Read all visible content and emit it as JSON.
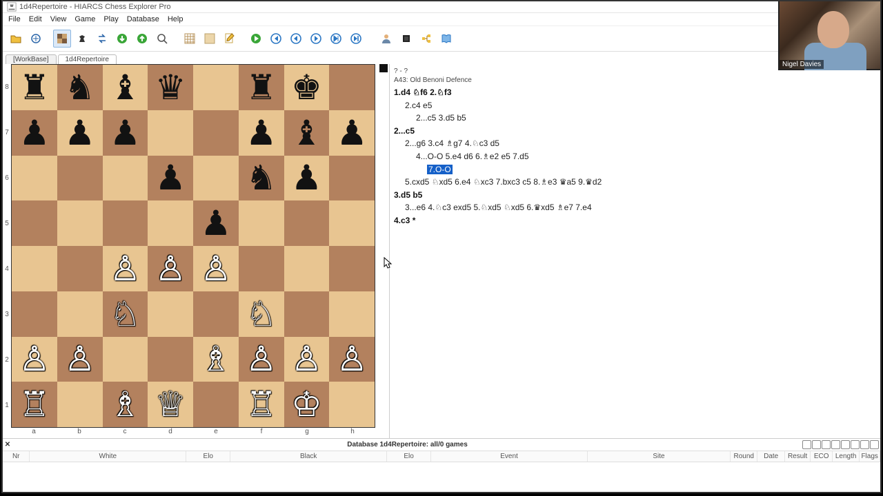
{
  "window": {
    "title": "1d4Repertoire - HIARCS Chess Explorer Pro"
  },
  "menus": [
    "File",
    "Edit",
    "View",
    "Game",
    "Play",
    "Database",
    "Help"
  ],
  "tabs": [
    {
      "label": "[WorkBase]",
      "active": false
    },
    {
      "label": "1d4Repertoire",
      "active": true
    }
  ],
  "board": {
    "files": [
      "a",
      "b",
      "c",
      "d",
      "e",
      "f",
      "g",
      "h"
    ],
    "ranks": [
      "8",
      "7",
      "6",
      "5",
      "4",
      "3",
      "2",
      "1"
    ],
    "side_to_move": "black",
    "position": {
      "a8": "bR",
      "b8": "bN",
      "c8": "bB",
      "d8": "bQ",
      "f8": "bR",
      "g8": "bK",
      "a7": "bP",
      "b7": "bP",
      "c7": "bP",
      "f7": "bP",
      "g7": "bB",
      "h7": "bP",
      "d6": "bP",
      "f6": "bN",
      "g6": "bP",
      "e5": "bP",
      "c4": "wP",
      "d4": "wP",
      "e4": "wP",
      "c3": "wN",
      "f3": "wN",
      "a2": "wP",
      "b2": "wP",
      "e2": "wB",
      "f2": "wP",
      "g2": "wP",
      "h2": "wP",
      "a1": "wR",
      "c1": "wB",
      "d1": "wQ",
      "f1": "wR",
      "g1": "wK"
    }
  },
  "gameinfo": {
    "header": "? - ?",
    "eco": "A43: Old Benoni Defence"
  },
  "moves": {
    "l1": "1.d4 ♘f6 2.♘f3",
    "l2": "2.c4 e5",
    "l3": "2...c5 3.d5 b5",
    "l4": "2...c5",
    "l5a": "2...g6 3.c4 ♗g7 4.♘c3 d5",
    "l6a": "4...O-O 5.e4 d6 6.♗e2 e5 7.d5",
    "l6hl": "7.O-O",
    "l7": "5.cxd5 ♘xd5 6.e4 ♘xc3 7.bxc3 c5 8.♗e3 ♛a5 9.♛d2",
    "l8": "3.d5 b5",
    "l9": "3...e6 4.♘c3 exd5 5.♘xd5 ♘xd5 6.♛xd5 ♗e7 7.e4",
    "l10": "4.c3 *"
  },
  "status": {
    "label": "Database 1d4Repertoire: all/0 games"
  },
  "columns": [
    "Nr",
    "White",
    "Elo",
    "Black",
    "Elo",
    "Event",
    "Site",
    "Round",
    "Date",
    "Result",
    "ECO",
    "Length",
    "Flags"
  ],
  "webcam": {
    "name": "Nigel Davies"
  },
  "piece_glyph": {
    "wK": "♔",
    "wQ": "♕",
    "wR": "♖",
    "wB": "♗",
    "wN": "♘",
    "wP": "♙",
    "bK": "♚",
    "bQ": "♛",
    "bR": "♜",
    "bB": "♝",
    "bN": "♞",
    "bP": "♟"
  }
}
